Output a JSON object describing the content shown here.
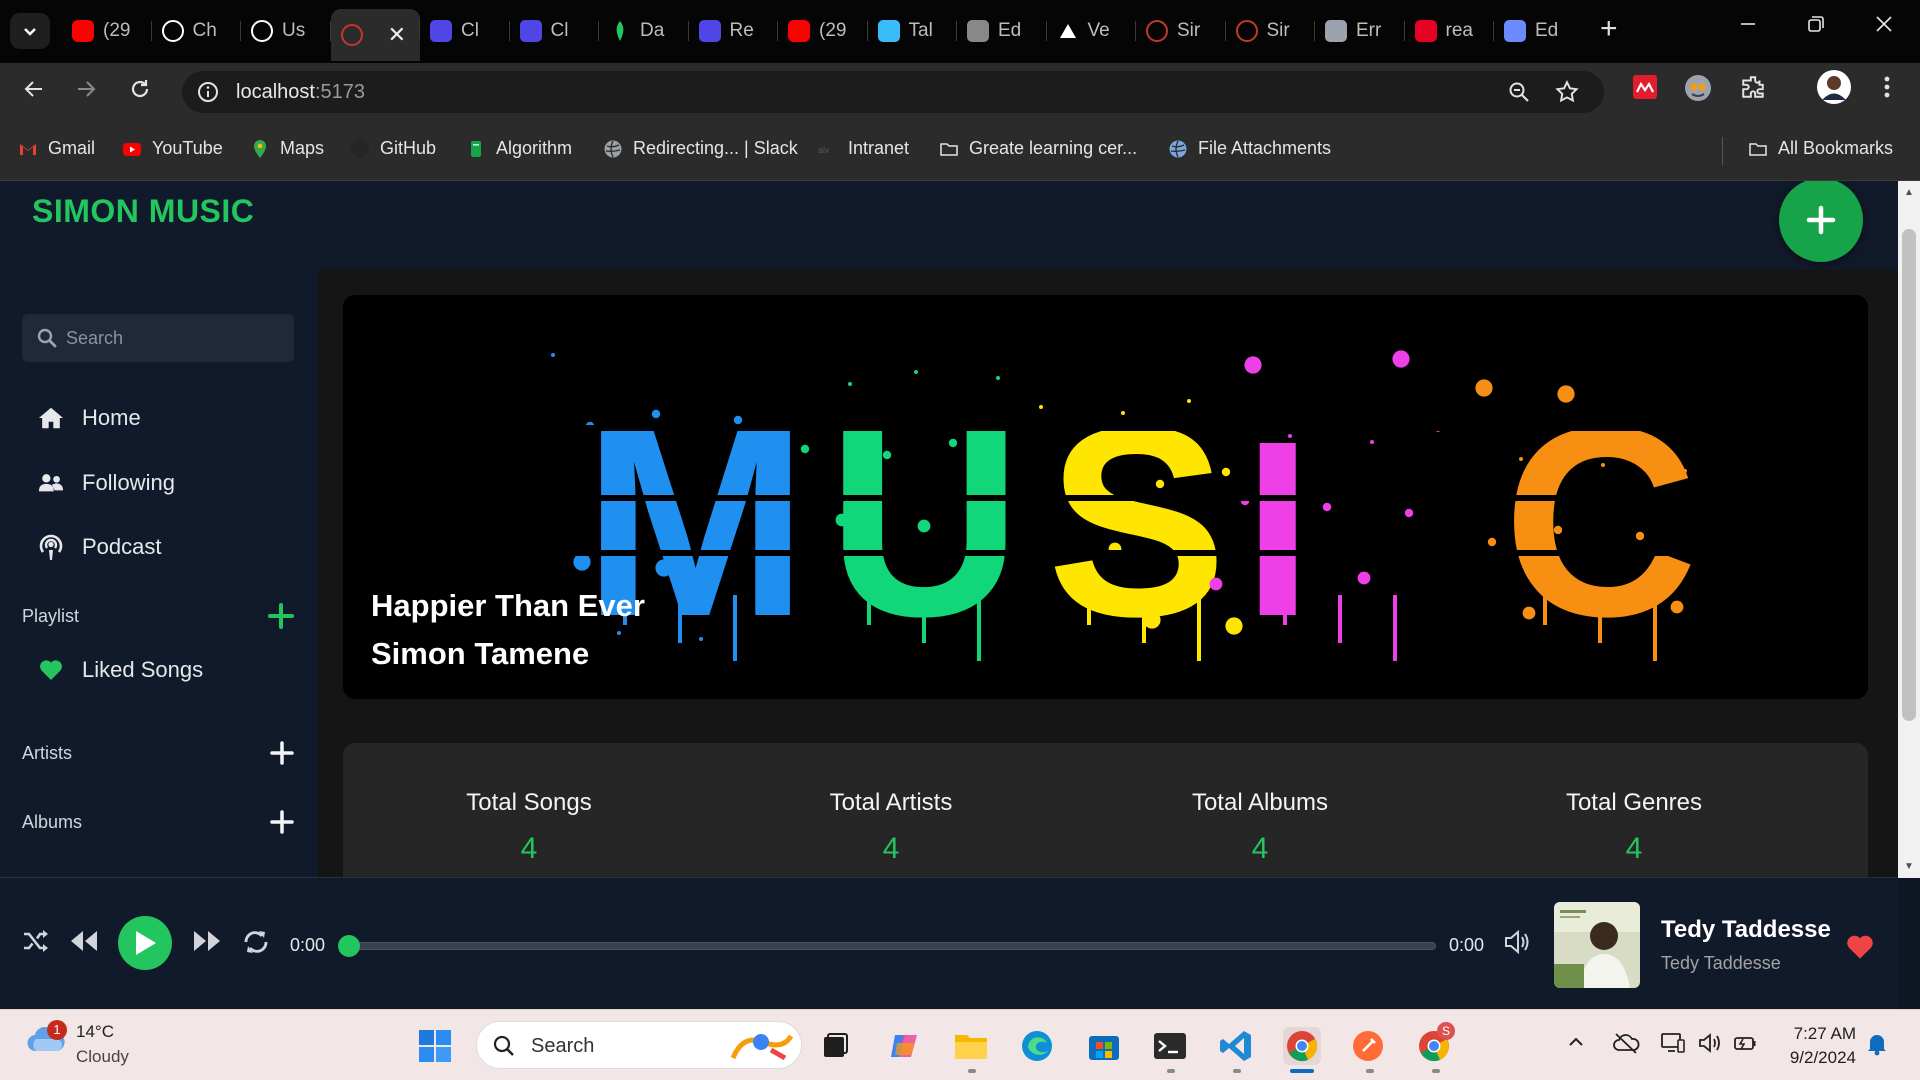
{
  "browser": {
    "tabs": [
      {
        "label": "(29",
        "icon": "youtube-icon",
        "color": "#ff0000"
      },
      {
        "label": "Ch",
        "icon": "openai-icon",
        "color": "#ffffff"
      },
      {
        "label": "Us",
        "icon": "openai-icon",
        "color": "#ffffff"
      },
      {
        "label": "",
        "icon": "record-icon",
        "color": "#c0392b",
        "active": true
      },
      {
        "label": "Cl",
        "icon": "cloud-icon",
        "color": "#4f46e5"
      },
      {
        "label": "Cl",
        "icon": "cloud-icon",
        "color": "#4f46e5"
      },
      {
        "label": "Da",
        "icon": "mongodb-icon",
        "color": "#22c55e"
      },
      {
        "label": "Re",
        "icon": "cloud-icon",
        "color": "#4f46e5"
      },
      {
        "label": "(29",
        "icon": "youtube-icon",
        "color": "#ff0000"
      },
      {
        "label": "Tal",
        "icon": "tailwind-icon",
        "color": "#38bdf8"
      },
      {
        "label": "Ed",
        "icon": "github-icon",
        "color": "#888888"
      },
      {
        "label": "Ve",
        "icon": "vercel-icon",
        "color": "#ffffff"
      },
      {
        "label": "Sir",
        "icon": "record-icon",
        "color": "#c0392b"
      },
      {
        "label": "Sir",
        "icon": "record-icon",
        "color": "#c0392b"
      },
      {
        "label": "Err",
        "icon": "globe-icon",
        "color": "#9ca3af"
      },
      {
        "label": "rea",
        "icon": "pinterest-icon",
        "color": "#e60023"
      },
      {
        "label": "Ed",
        "icon": "medium-icon",
        "color": "#6b8afd"
      }
    ],
    "url_host": "localhost",
    "url_port": ":5173",
    "bookmarks": [
      {
        "label": "Gmail",
        "icon": "gmail-icon"
      },
      {
        "label": "YouTube",
        "icon": "youtube-icon"
      },
      {
        "label": "Maps",
        "icon": "maps-icon"
      },
      {
        "label": "GitHub",
        "icon": "github-icon"
      },
      {
        "label": "Algorithm",
        "icon": "book-icon"
      },
      {
        "label": "Redirecting... | Slack",
        "icon": "globe-icon"
      },
      {
        "label": "Intranet",
        "icon": "intranet-icon"
      },
      {
        "label": "Greate learning cer...",
        "icon": "folder-icon"
      },
      {
        "label": "File Attachments",
        "icon": "globe-icon"
      }
    ],
    "all_bookmarks": "All Bookmarks"
  },
  "app": {
    "brand": "SIMON MUSIC",
    "search_placeholder": "Search",
    "nav": [
      {
        "label": "Home",
        "icon": "home-icon"
      },
      {
        "label": "Following",
        "icon": "users-icon"
      },
      {
        "label": "Podcast",
        "icon": "podcast-icon"
      }
    ],
    "playlist_label": "Playlist",
    "liked_songs": "Liked Songs",
    "artists_label": "Artists",
    "albums_label": "Albums",
    "hero": {
      "line1": "Happier Than Ever",
      "line2": "Simon Tamene",
      "letters": [
        "M",
        "U",
        "S",
        "I",
        "C"
      ],
      "letter_colors": [
        "#1f8ff0",
        "#12d67a",
        "#ffe600",
        "#ef3fe6",
        "#f78f12"
      ]
    },
    "stats": [
      {
        "label": "Total Songs",
        "value": "4"
      },
      {
        "label": "Total Artists",
        "value": "4"
      },
      {
        "label": "Total Albums",
        "value": "4"
      },
      {
        "label": "Total Genres",
        "value": "4"
      }
    ],
    "accent": "#22c55e"
  },
  "player": {
    "current_time": "0:00",
    "duration": "0:00",
    "progress": 0,
    "title": "Tedy Taddesse",
    "artist": "Tedy Taddesse"
  },
  "taskbar": {
    "temp": "14°C",
    "weather": "Cloudy",
    "badge": "1",
    "search_label": "Search",
    "time": "7:27 AM",
    "date": "9/2/2024",
    "chrome_badge": "S"
  }
}
